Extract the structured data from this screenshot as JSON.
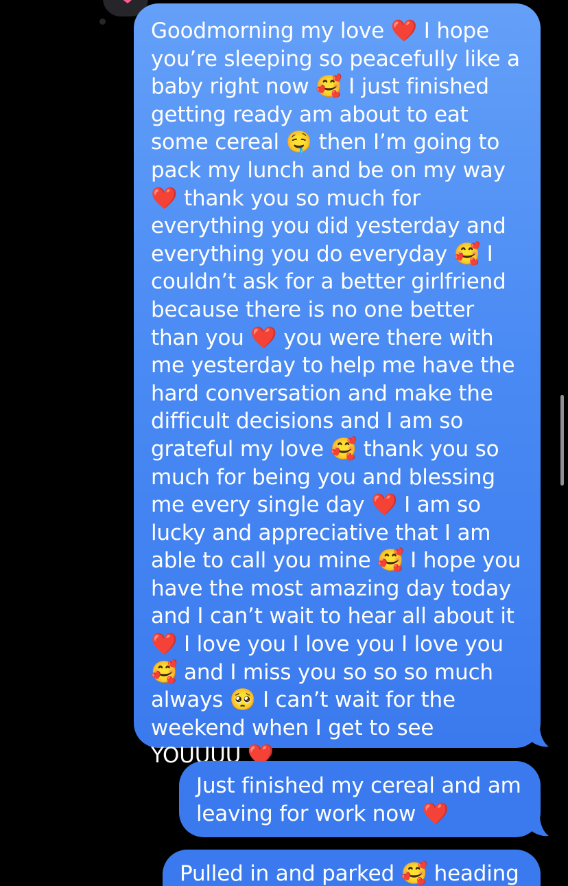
{
  "tapback": {
    "icon": "heart-icon",
    "color": "#ff5a8a"
  },
  "messages": [
    {
      "text": "Goodmorning my love ❤️ I hope you’re sleeping so peacefully like a baby right now 🥰 I just finished getting ready am about to eat some cereal 🤤 then I’m going to pack my lunch and be on my way ❤️ thank you so much for everything you did yesterday and everything you do everyday 🥰 I couldn’t ask for a better girlfriend because there is no one better than you ❤️ you were there with me yesterday to help me have the hard conversation and make the difficult decisions and I am so grateful my love 🥰 thank you so much for being you and blessing me every single day ❤️ I am so lucky and appreciative that I am able to call you mine 🥰 I hope you have the most amazing day today and I can’t wait to hear all about it ❤️ I love you I love you I love you 🥰 and I miss you so so so much always 🥺 I can’t wait for the weekend when I get to see YOUUUU ❤️"
    },
    {
      "text": "Just finished my cereal and am leaving for work now ❤️"
    },
    {
      "text": "Pulled in and parked 🥰 heading"
    }
  ],
  "colors": {
    "background": "#000000",
    "bubble_top": "#64a0f8",
    "bubble_bottom": "#3a7aee",
    "text": "#ffffff"
  }
}
